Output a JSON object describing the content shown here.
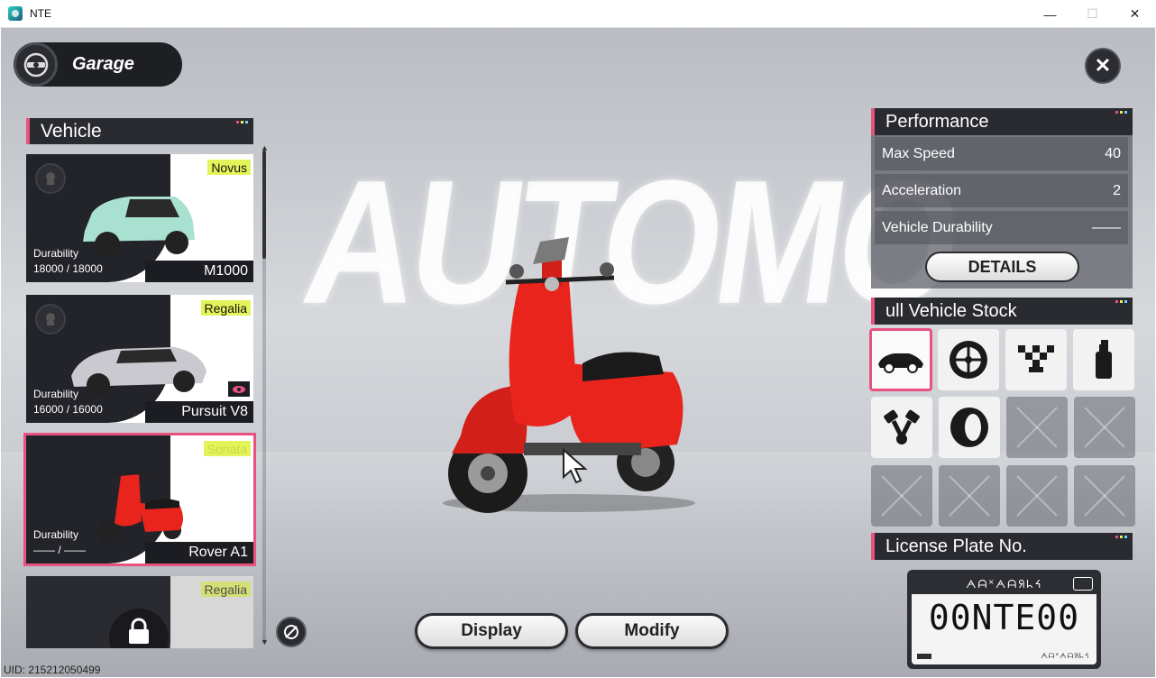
{
  "window": {
    "title": "NTE",
    "minimize": "—",
    "maximize": "☐",
    "close": "✕"
  },
  "backdrop": {
    "text": "AUTOMO"
  },
  "garage": {
    "label": "Garage",
    "close_glyph": "✕"
  },
  "vehicle_list": {
    "header": "Vehicle",
    "durability_label": "Durability",
    "cards": [
      {
        "badge": "Novus",
        "durability": "18000 / 18000",
        "name": "M1000",
        "body_color": "#a8e1cf"
      },
      {
        "badge": "Regalia",
        "durability": "16000 / 16000",
        "name": "Pursuit V8",
        "body_color": "#c9c9cf"
      },
      {
        "badge": "Sonata",
        "durability": "—— / ——",
        "name": "Rover A1",
        "body_color": "#e8241d",
        "selected": true
      },
      {
        "badge": "Regalia",
        "durability": "",
        "name": "",
        "locked": true
      }
    ]
  },
  "bottom_buttons": {
    "display": "Display",
    "modify": "Modify"
  },
  "uid": "UID: 215212050499",
  "performance": {
    "header": "Performance",
    "rows": [
      {
        "label": "Max Speed",
        "value": "40"
      },
      {
        "label": "Acceleration",
        "value": "2"
      },
      {
        "label": "Vehicle Durability",
        "value": "——"
      }
    ],
    "details_label": "DETAILS"
  },
  "stock": {
    "header": "ull Vehicle  Stock",
    "icons": [
      "car-body-icon",
      "wheel-rim-icon",
      "checkered-flag-icon",
      "spray-paint-icon",
      "engine-piston-icon",
      "tire-icon"
    ]
  },
  "license_plate": {
    "header": "License Plate No.",
    "top_text": "ᗅᗩᕁᗅᗩᖆᖺᔦ",
    "number": "00NTE00",
    "bottom_text": "ᗅᗩᕁᗅᗩᖆᖺᔦ"
  },
  "colors": {
    "accent": "#e8527f",
    "badge": "#e3f35a",
    "panel_dark": "#2a2b30",
    "scooter_red": "#e8241d"
  }
}
